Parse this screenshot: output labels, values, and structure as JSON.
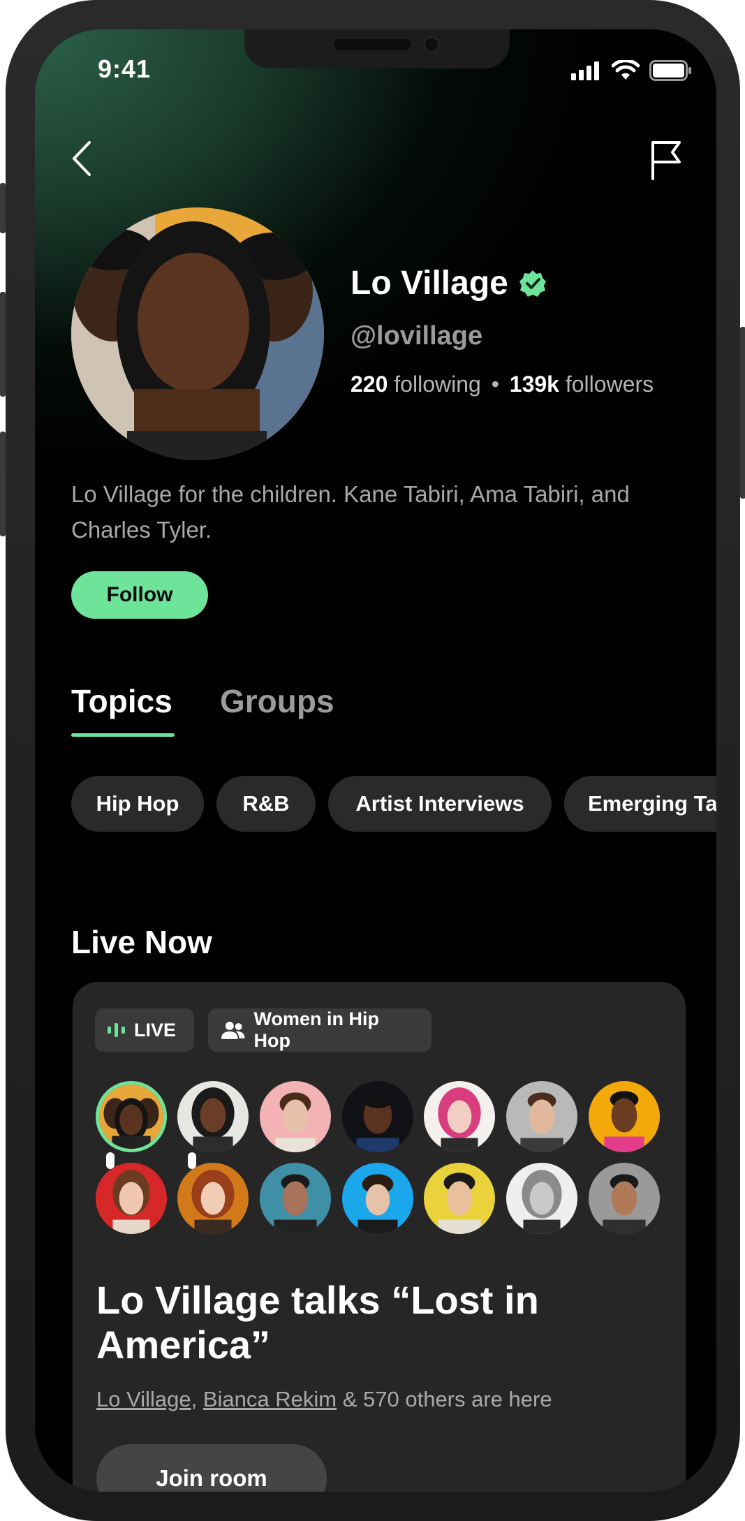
{
  "status_bar": {
    "time": "9:41"
  },
  "profile": {
    "name": "Lo Village",
    "handle": "@lovillage",
    "following_count": "220",
    "following_label": "following",
    "separator": "•",
    "followers_count": "139k",
    "followers_label": "followers",
    "bio": "Lo Village for the children. Kane Tabiri, Ama Tabiri, and Charles Tyler.",
    "follow_label": "Follow",
    "verified": true
  },
  "tabs": [
    {
      "label": "Topics",
      "active": true
    },
    {
      "label": "Groups",
      "active": false
    }
  ],
  "topics": [
    "Hip Hop",
    "R&B",
    "Artist Interviews",
    "Emerging Talent"
  ],
  "live_now": {
    "heading": "Live Now",
    "live_label": "LIVE",
    "group_label": "Women in Hip Hop",
    "room_title": "Lo Village talks “Lost in America”",
    "participants": [
      "Lo Village",
      "Bianca Rekim"
    ],
    "comma": ",",
    "others_text": " & 570 others are here",
    "join_label": "Join room"
  },
  "colors": {
    "accent": "#6ee39a",
    "card": "#262626",
    "chip": "#2a2a2a",
    "gradient_green": "#2c6048"
  },
  "icons": [
    "back-chevron-icon",
    "flag-icon",
    "verified-badge-icon",
    "signal-icon",
    "wifi-icon",
    "battery-icon",
    "live-bars-icon",
    "group-people-icon",
    "mic-icon"
  ]
}
